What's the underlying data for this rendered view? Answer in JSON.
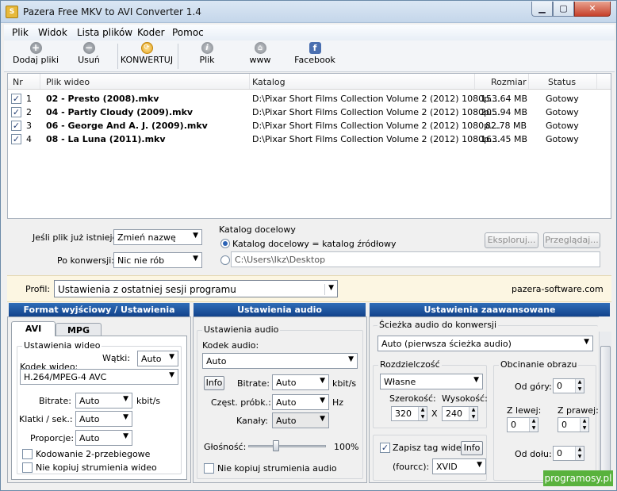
{
  "window": {
    "title": "Pazera Free MKV to AVI Converter 1.4",
    "app_icon_letter": "S",
    "min_glyph": "▁",
    "max_glyph": "▢",
    "close_glyph": "✕"
  },
  "menu": [
    "Plik",
    "Widok",
    "Lista plików",
    "Koder",
    "Pomoc"
  ],
  "toolbar": {
    "add": "Dodaj pliki",
    "remove": "Usuń",
    "convert": "KONWERTUJ",
    "file": "Plik",
    "www": "www",
    "facebook": "Facebook"
  },
  "list": {
    "headers": {
      "nr": "Nr",
      "file": "Plik wideo",
      "dir": "Katalog",
      "size": "Rozmiar",
      "status": "Status"
    },
    "rows": [
      {
        "nr": "1",
        "file": "02 - Presto (2008).mkv",
        "dir": "D:\\Pixar Short Films Collection Volume 2 (2012) 1080p....",
        "size": "153.64 MB",
        "status": "Gotowy",
        "checked": true
      },
      {
        "nr": "2",
        "file": "04 - Partly Cloudy (2009).mkv",
        "dir": "D:\\Pixar Short Films Collection Volume 2 (2012) 1080p....",
        "size": "205.94 MB",
        "status": "Gotowy",
        "checked": true
      },
      {
        "nr": "3",
        "file": "06 - George And A. J. (2009).mkv",
        "dir": "D:\\Pixar Short Films Collection Volume 2 (2012) 1080p....",
        "size": "82.78 MB",
        "status": "Gotowy",
        "checked": true
      },
      {
        "nr": "4",
        "file": "08 - La Luna (2011).mkv",
        "dir": "D:\\Pixar Short Films Collection Volume 2 (2012) 1080p....",
        "size": "163.45 MB",
        "status": "Gotowy",
        "checked": true
      }
    ]
  },
  "opts": {
    "exists_label": "Jeśli plik już istnieje:",
    "exists_value": "Zmień nazwę",
    "after_label": "Po konwersji:",
    "after_value": "Nic nie rób",
    "target_title": "Katalog docelowy",
    "radio_same": "Katalog docelowy = katalog źródłowy",
    "custom_path": "C:\\Users\\Ikz\\Desktop",
    "explore": "Eksploruj...",
    "browse": "Przeglądaj..."
  },
  "profile": {
    "label": "Profil:",
    "value": "Ustawienia z ostatniej sesji programu",
    "site": "pazera-software.com"
  },
  "video": {
    "header": "Format wyjściowy / Ustawienia wideo",
    "tab_avi": "AVI",
    "tab_mpg": "MPG",
    "group": "Ustawienia wideo",
    "codec_label": "Kodek wideo:",
    "threads_label": "Wątki:",
    "threads_value": "Auto",
    "codec_value": "H.264/MPEG-4 AVC",
    "bitrate_label": "Bitrate:",
    "bitrate_value": "Auto",
    "bitrate_unit": "kbit/s",
    "fps_label": "Klatki / sek.:",
    "fps_value": "Auto",
    "aspect_label": "Proporcje:",
    "aspect_value": "Auto",
    "twopass": "Kodowanie 2-przebiegowe",
    "nocopy": "Nie kopiuj strumienia wideo"
  },
  "audio": {
    "header": "Ustawienia audio",
    "group": "Ustawienia audio",
    "codec_label": "Kodek audio:",
    "codec_value": "Auto",
    "info": "Info",
    "bitrate_label": "Bitrate:",
    "bitrate_value": "Auto",
    "bitrate_unit": "kbit/s",
    "sample_label": "Częst. próbk.:",
    "sample_value": "Auto",
    "sample_unit": "Hz",
    "channels_label": "Kanały:",
    "channels_value": "Auto",
    "volume_label": "Głośność:",
    "volume_value": "100%",
    "volume_level": 0.34,
    "nocopy": "Nie kopiuj strumienia audio"
  },
  "advanced": {
    "header": "Ustawienia zaawansowane",
    "track_label": "Ścieżka audio do konwersji",
    "track_value": "Auto (pierwsza ścieżka audio)",
    "res_group": "Rozdzielczość",
    "res_value": "Własne",
    "width_label": "Szerokość:",
    "width_value": "320",
    "height_label": "Wysokość:",
    "height_value": "240",
    "x": "X",
    "fourcc_check": "Zapisz tag wideo",
    "fourcc_info": "Info",
    "fourcc_label": "(fourcc):",
    "fourcc_value": "XVID",
    "crop_group": "Obcinanie obrazu",
    "crop_top": "Od góry:",
    "crop_top_v": "0",
    "crop_left": "Z lewej:",
    "crop_left_v": "0",
    "crop_right": "Z prawej:",
    "crop_right_v": "0",
    "crop_bottom": "Od dołu:",
    "crop_bottom_v": "0"
  },
  "watermark": "programosy.pl",
  "colors": {
    "header_blue": "#1b4f97",
    "profile_bg": "#fcf6e2",
    "watermark_green": "#59b23d"
  }
}
